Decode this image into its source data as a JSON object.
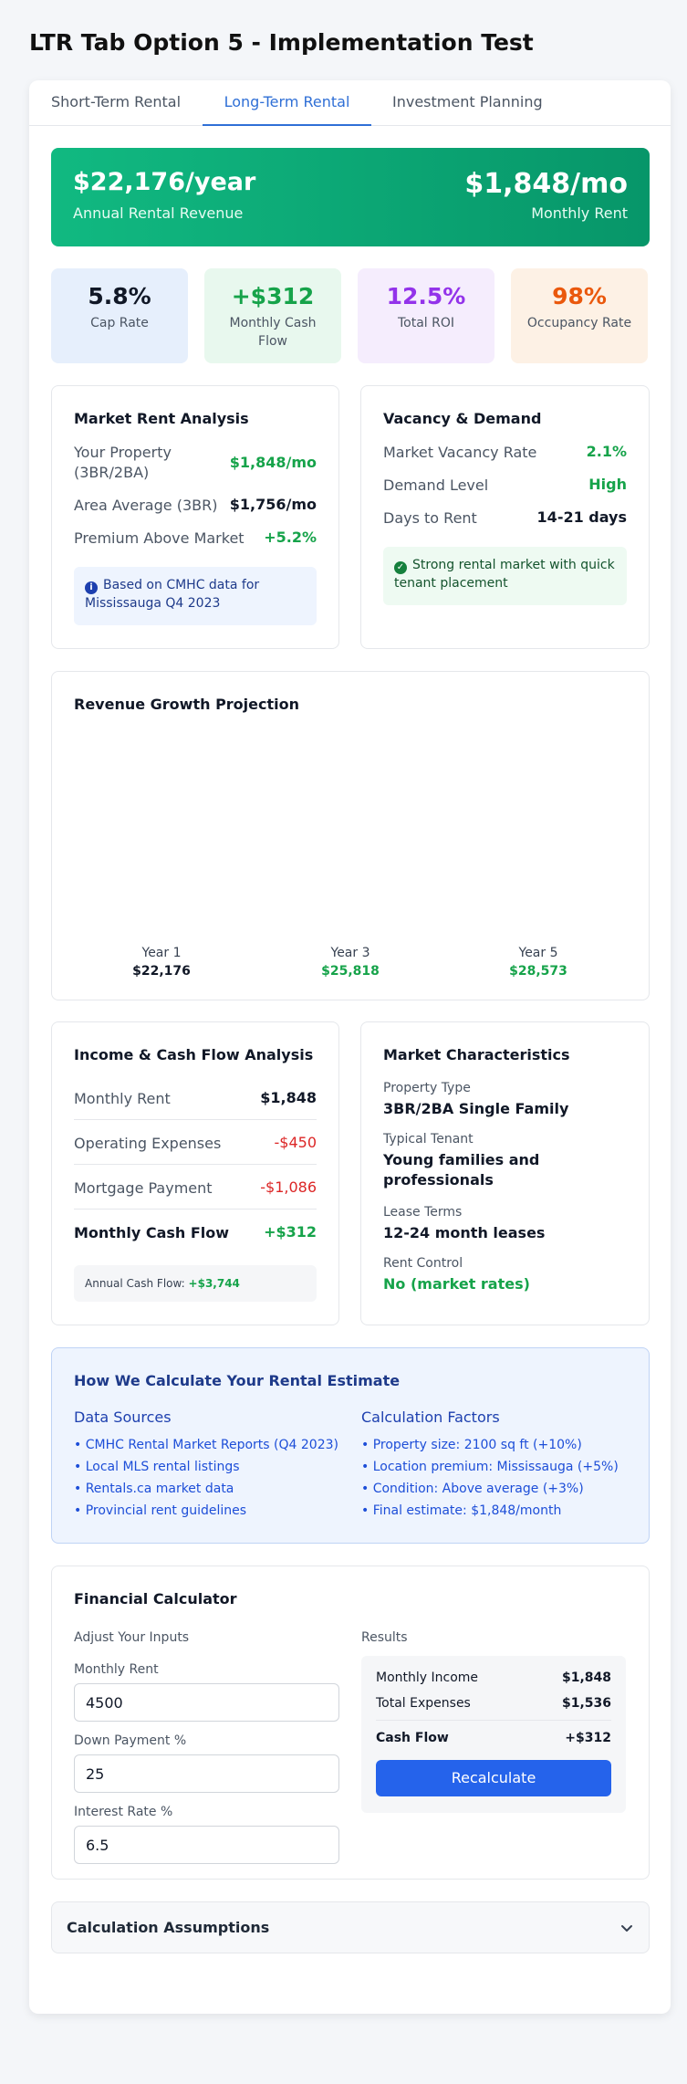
{
  "page": {
    "title": "LTR Tab Option 5 - Implementation Test"
  },
  "tabs": [
    {
      "label": "Short-Term Rental",
      "active": false
    },
    {
      "label": "Long-Term Rental",
      "active": true
    },
    {
      "label": "Investment Planning",
      "active": false
    }
  ],
  "hero": {
    "annual_value": "$22,176/year",
    "annual_label": "Annual Rental Revenue",
    "monthly_value": "$1,848/mo",
    "monthly_label": "Monthly Rent"
  },
  "kpis": [
    {
      "value": "5.8%",
      "label": "Cap Rate",
      "color": "#111827",
      "bg": "#e6effc"
    },
    {
      "value": "+$312",
      "label": "Monthly Cash Flow",
      "color": "#16a34a",
      "bg": "#e8f8ee"
    },
    {
      "value": "12.5%",
      "label": "Total ROI",
      "color": "#9333ea",
      "bg": "#f5edfd"
    },
    {
      "value": "98%",
      "label": "Occupancy Rate",
      "color": "#ea580c",
      "bg": "#fdf1e5"
    }
  ],
  "market_rent": {
    "title": "Market Rent Analysis",
    "rows": [
      {
        "label": "Your Property (3BR/2BA)",
        "value": "$1,848/mo",
        "color": "#16a34a"
      },
      {
        "label": "Area Average (3BR)",
        "value": "$1,756/mo",
        "color": "#111827"
      },
      {
        "label": "Premium Above Market",
        "value": "+5.2%",
        "color": "#16a34a"
      }
    ],
    "note": "Based on CMHC data for Mississauga Q4 2023"
  },
  "vacancy": {
    "title": "Vacancy & Demand",
    "rows": [
      {
        "label": "Market Vacancy Rate",
        "value": "2.1%",
        "color": "#16a34a"
      },
      {
        "label": "Demand Level",
        "value": "High",
        "color": "#16a34a"
      },
      {
        "label": "Days to Rent",
        "value": "14-21 days",
        "color": "#111827"
      }
    ],
    "note": "Strong rental market with quick tenant placement"
  },
  "projection": {
    "title": "Revenue Growth Projection"
  },
  "chart_data": {
    "type": "bar",
    "title": "Revenue Growth Projection",
    "categories": [
      "Year 1",
      "Year 3",
      "Year 5"
    ],
    "values": [
      22176,
      25818,
      28573
    ],
    "value_labels": [
      "$22,176",
      "$25,818",
      "$28,573"
    ],
    "value_colors": [
      "#111827",
      "#16a34a",
      "#16a34a"
    ]
  },
  "cashflow": {
    "title": "Income & Cash Flow Analysis",
    "rows": [
      {
        "label": "Monthly Rent",
        "value": "$1,848",
        "color": "#111827"
      },
      {
        "label": "Operating Expenses",
        "value": "-$450",
        "color": "#dc2626"
      },
      {
        "label": "Mortgage Payment",
        "value": "-$1,086",
        "color": "#dc2626"
      },
      {
        "label": "Monthly Cash Flow",
        "value": "+$312",
        "color": "#16a34a"
      }
    ],
    "annual_label": "Annual Cash Flow:",
    "annual_value": "+$3,744"
  },
  "market_char": {
    "title": "Market Characteristics",
    "items": [
      {
        "label": "Property Type",
        "value": "3BR/2BA Single Family",
        "color": "#111827"
      },
      {
        "label": "Typical Tenant",
        "value": "Young families and professionals",
        "color": "#111827"
      },
      {
        "label": "Lease Terms",
        "value": "12-24 month leases",
        "color": "#111827"
      },
      {
        "label": "Rent Control",
        "value": "No (market rates)",
        "color": "#16a34a"
      }
    ]
  },
  "how": {
    "title": "How We Calculate Your Rental Estimate",
    "sources_title": "Data Sources",
    "sources": [
      "• CMHC Rental Market Reports (Q4 2023)",
      "• Local MLS rental listings",
      "• Rentals.ca market data",
      "• Provincial rent guidelines"
    ],
    "factors_title": "Calculation Factors",
    "factors": [
      "• Property size: 2100 sq ft (+10%)",
      "• Location premium: Mississauga (+5%)",
      "• Condition: Above average (+3%)",
      "• Final estimate: $1,848/month"
    ]
  },
  "calculator": {
    "title": "Financial Calculator",
    "inputs_title": "Adjust Your Inputs",
    "rent_label": "Monthly Rent",
    "rent_value": "4500",
    "down_label": "Down Payment %",
    "down_value": "25",
    "rate_label": "Interest Rate %",
    "rate_value": "6.5",
    "results_title": "Results",
    "income_label": "Monthly Income",
    "income_value": "$1,848",
    "expenses_label": "Total Expenses",
    "expenses_value": "$1,536",
    "cash_label": "Cash Flow",
    "cash_value": "+$312",
    "button": "Recalculate"
  },
  "assumptions": {
    "title": "Calculation Assumptions"
  }
}
